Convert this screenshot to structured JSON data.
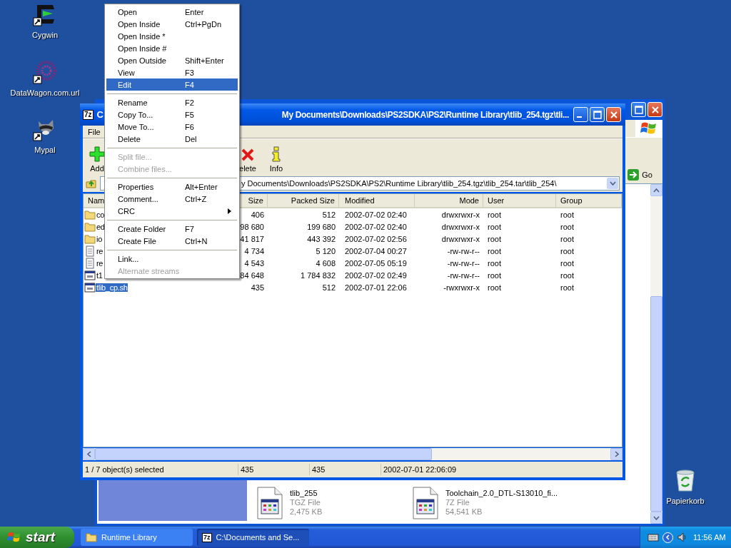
{
  "desktop_icons": [
    {
      "kind": "terminal",
      "label": "Cygwin"
    },
    {
      "kind": "web-link",
      "label": "DataWagon.com.url"
    },
    {
      "kind": "raccoon",
      "label": "Mypal"
    }
  ],
  "recycle_bin": {
    "label": "Papierkorb"
  },
  "explorer_window": {
    "go_button": "Go",
    "files": [
      {
        "name": "tlib_255",
        "type": "TGZ File",
        "size": "2,475 KB"
      },
      {
        "name": "Toolchain_2.0_DTL-S13010_fi...",
        "type": "7Z File",
        "size": "54,541 KB"
      }
    ]
  },
  "archive_window": {
    "app_icon": "7z",
    "title_start": "C",
    "title_end": "My Documents\\Downloads\\PS2SDKA\\PS2\\Runtime Library\\tlib_254.tgz\\tli...",
    "menu": [
      "File"
    ],
    "toolbar": [
      {
        "kind": "add",
        "label": "Add"
      },
      {
        "kind": "delete",
        "label": "elete"
      },
      {
        "kind": "info",
        "label": "Info"
      }
    ],
    "address": "y Documents\\Downloads\\PS2SDKA\\PS2\\Runtime Library\\tlib_254.tgz\\tlib_254.tar\\tlib_254\\",
    "columns": [
      "Nam",
      "Size",
      "Packed Size",
      "Modified",
      "Mode",
      "User",
      "Group"
    ],
    "rows": [
      {
        "kind": "folder",
        "name": "co",
        "size": "406",
        "packed_size": "512",
        "modified": "2002-07-02 02:40",
        "mode": "drwxrwxr-x",
        "user": "root",
        "group": "root",
        "selected": false
      },
      {
        "kind": "folder",
        "name": "ed",
        "size": "98 680",
        "packed_size": "199 680",
        "modified": "2002-07-02 02:40",
        "mode": "drwxrwxr-x",
        "user": "root",
        "group": "root",
        "selected": false
      },
      {
        "kind": "folder",
        "name": "io",
        "size": "41 817",
        "packed_size": "443 392",
        "modified": "2002-07-02 02:56",
        "mode": "drwxrwxr-x",
        "user": "root",
        "group": "root",
        "selected": false
      },
      {
        "kind": "text",
        "name": "re",
        "size": "4 734",
        "packed_size": "5 120",
        "modified": "2002-07-04 00:27",
        "mode": "-rw-rw-r--",
        "user": "root",
        "group": "root",
        "selected": false
      },
      {
        "kind": "text",
        "name": "re",
        "size": "4 543",
        "packed_size": "4 608",
        "modified": "2002-07-05 05:19",
        "mode": "-rw-rw-r--",
        "user": "root",
        "group": "root",
        "selected": false
      },
      {
        "kind": "program",
        "name": "t1",
        "size": "84 648",
        "packed_size": "1 784 832",
        "modified": "2002-07-02 02:49",
        "mode": "-rw-rw-r--",
        "user": "root",
        "group": "root",
        "selected": false
      },
      {
        "kind": "program",
        "name": "tlib_cp.sh",
        "size": "435",
        "packed_size": "512",
        "modified": "2002-07-01 22:06",
        "mode": "-rwxrwxr-x",
        "user": "root",
        "group": "root",
        "selected": true
      }
    ],
    "status": [
      "1 / 7 object(s) selected",
      "435",
      "435",
      "2002-07-01 22:06:09"
    ]
  },
  "context_menu": {
    "groups": [
      [
        {
          "label": "Open",
          "shortcut": "Enter",
          "disabled": false,
          "selected": false,
          "submenu": false
        },
        {
          "label": "Open Inside",
          "shortcut": "Ctrl+PgDn",
          "disabled": false,
          "selected": false,
          "submenu": false
        },
        {
          "label": "Open Inside *",
          "disabled": false,
          "selected": false,
          "submenu": false
        },
        {
          "label": "Open Inside #",
          "disabled": false,
          "selected": false,
          "submenu": false
        },
        {
          "label": "Open Outside",
          "shortcut": "Shift+Enter",
          "disabled": false,
          "selected": false,
          "submenu": false
        },
        {
          "label": "View",
          "shortcut": "F3",
          "disabled": false,
          "selected": false,
          "submenu": false
        },
        {
          "label": "Edit",
          "shortcut": "F4",
          "disabled": false,
          "selected": true,
          "submenu": false
        }
      ],
      [
        {
          "label": "Rename",
          "shortcut": "F2",
          "disabled": false,
          "selected": false,
          "submenu": false
        },
        {
          "label": "Copy To...",
          "shortcut": "F5",
          "disabled": false,
          "selected": false,
          "submenu": false
        },
        {
          "label": "Move To...",
          "shortcut": "F6",
          "disabled": false,
          "selected": false,
          "submenu": false
        },
        {
          "label": "Delete",
          "shortcut": "Del",
          "disabled": false,
          "selected": false,
          "submenu": false
        }
      ],
      [
        {
          "label": "Split file...",
          "disabled": true,
          "selected": false,
          "submenu": false
        },
        {
          "label": "Combine files...",
          "disabled": true,
          "selected": false,
          "submenu": false
        }
      ],
      [
        {
          "label": "Properties",
          "shortcut": "Alt+Enter",
          "disabled": false,
          "selected": false,
          "submenu": false
        },
        {
          "label": "Comment...",
          "shortcut": "Ctrl+Z",
          "disabled": false,
          "selected": false,
          "submenu": false
        },
        {
          "label": "CRC",
          "disabled": false,
          "selected": false,
          "submenu": true
        }
      ],
      [
        {
          "label": "Create Folder",
          "shortcut": "F7",
          "disabled": false,
          "selected": false,
          "submenu": false
        },
        {
          "label": "Create File",
          "shortcut": "Ctrl+N",
          "disabled": false,
          "selected": false,
          "submenu": false
        }
      ],
      [
        {
          "label": "Link...",
          "disabled": false,
          "selected": false,
          "submenu": false
        },
        {
          "label": "Alternate streams",
          "disabled": true,
          "selected": false,
          "submenu": false
        }
      ]
    ]
  },
  "taskbar": {
    "start": "start",
    "buttons": [
      {
        "kind": "folder",
        "label": "Runtime Library",
        "selected": false
      },
      {
        "kind": "archive",
        "icon_text": "7z",
        "label": "C:\\Documents and Se...",
        "selected": true
      }
    ],
    "clock": "11:56 AM"
  }
}
